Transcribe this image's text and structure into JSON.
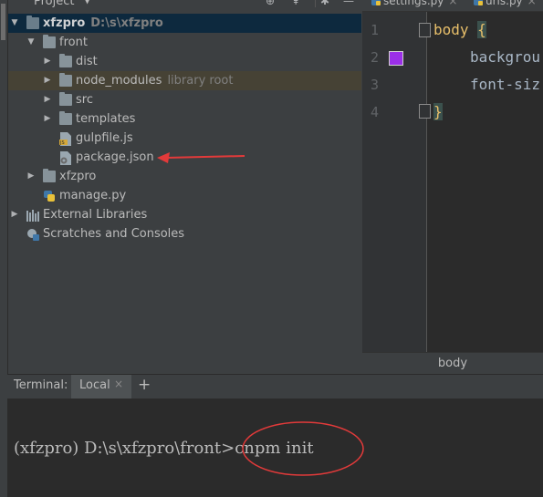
{
  "project_panel": {
    "title": "Project",
    "tree": [
      {
        "label": "xfzpro",
        "sub": "D:\\s\\xfzpro"
      },
      {
        "label": "front"
      },
      {
        "label": "dist"
      },
      {
        "label": "node_modules",
        "sub": "library root"
      },
      {
        "label": "src"
      },
      {
        "label": "templates"
      },
      {
        "label": "gulpfile.js"
      },
      {
        "label": "package.json"
      },
      {
        "label": "xfzpro"
      },
      {
        "label": "manage.py"
      },
      {
        "label": "External Libraries"
      },
      {
        "label": "Scratches and Consoles"
      }
    ]
  },
  "editor": {
    "tabs": [
      {
        "label": "settings.py"
      },
      {
        "label": "urls.py"
      }
    ],
    "line_numbers": [
      "1",
      "2",
      "3",
      "4"
    ],
    "lines": [
      {
        "selector": "body",
        "brace": "{"
      },
      {
        "text": "backgrou"
      },
      {
        "text": "font-siz"
      },
      {
        "brace": "}"
      }
    ],
    "swatch_color": "#9b2fe8",
    "breadcrumb": "body"
  },
  "terminal": {
    "title": "Terminal:",
    "tab_label": "Local",
    "add_label": "+",
    "line": "(xfzpro) D:\\s\\xfzpro\\front>cnpm init"
  },
  "annotation_color": "#e23a3a"
}
